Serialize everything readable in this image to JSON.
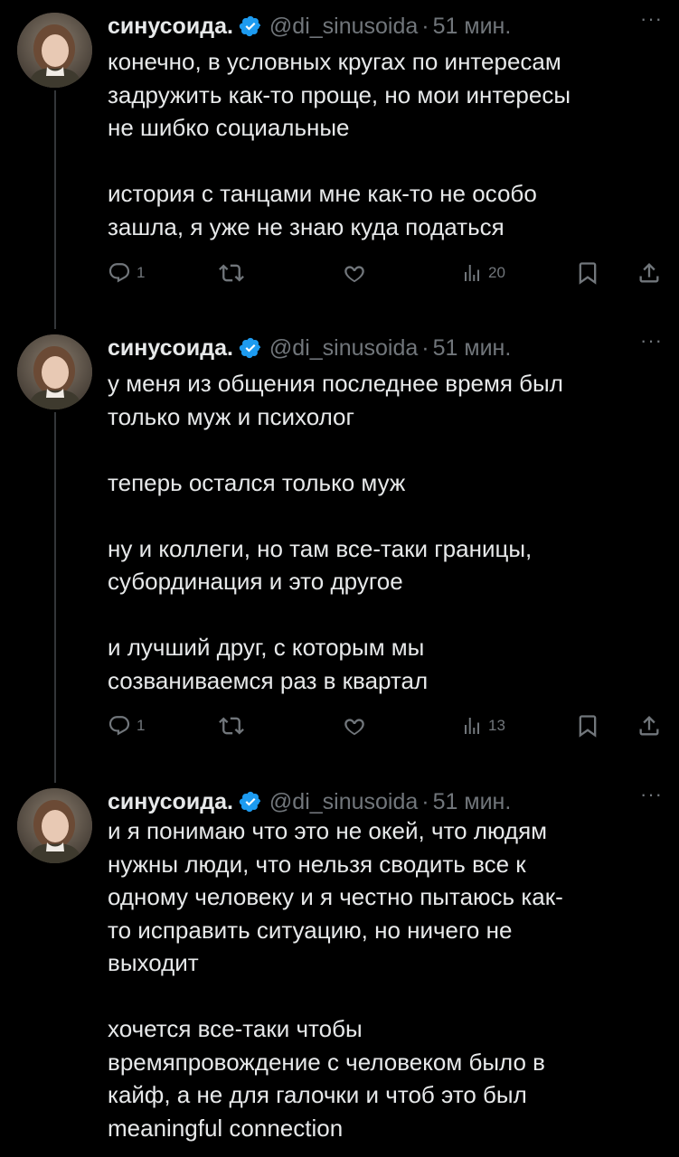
{
  "tweets": [
    {
      "author": "синусоида.",
      "handle": "@di_sinusoida",
      "separator": "·",
      "time": "51 мин.",
      "more": "···",
      "paragraphs": [
        "конечно, в условных кругах по интересам\nзадружить как-то проще, но мои интересы\nне шибко социальные",
        "история с танцами мне как-то не особо\nзашла, я уже не знаю куда податься"
      ],
      "replies": "1",
      "retweets": "",
      "likes": "",
      "views": "20"
    },
    {
      "author": "синусоида.",
      "handle": "@di_sinusoida",
      "separator": "·",
      "time": "51 мин.",
      "more": "···",
      "paragraphs": [
        "у меня из общения последнее время был\nтолько муж и психолог",
        "теперь остался только муж",
        "ну и коллеги, но там все-таки границы,\nсубординация и это другое",
        "и лучший друг, с которым мы\nсозваниваемся раз в квартал"
      ],
      "replies": "1",
      "retweets": "",
      "likes": "",
      "views": "13"
    },
    {
      "author": "синусоида.",
      "handle": "@di_sinusoida",
      "separator": "·",
      "time": "51 мин.",
      "more": "···",
      "paragraphs": [
        "и я понимаю что это не окей, что людям\nнужны люди, что нельзя сводить все к\nодному человеку и я честно пытаюсь как-\nто исправить ситуацию, но ничего не\nвыходит",
        "хочется все-таки чтобы\nвремяпровождение с человеком было в\nкайф, а не для галочки и чтоб это был\nmeaningful connection"
      ]
    }
  ],
  "icons": {
    "reply": "reply-icon",
    "retweet": "retweet-icon",
    "like": "heart-icon",
    "views": "views-icon",
    "bookmark": "bookmark-icon",
    "share": "share-icon",
    "verified": "verified-badge-icon"
  },
  "colors": {
    "background": "#000000",
    "text": "#e7e9ea",
    "secondary": "#71767b",
    "verified": "#1d9bf0",
    "thread_line": "#333639"
  }
}
